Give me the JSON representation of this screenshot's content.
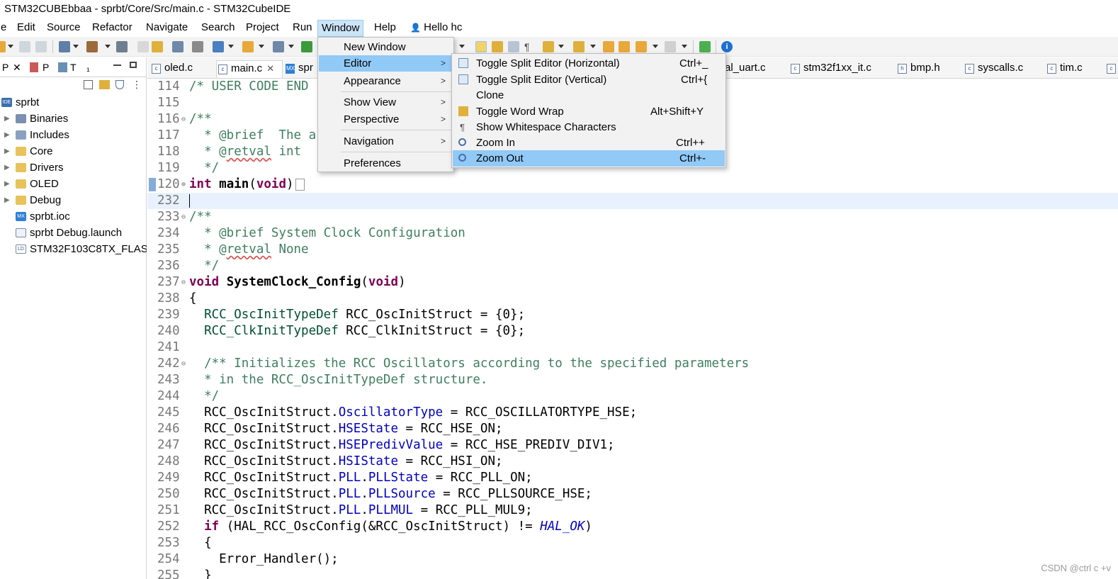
{
  "window": {
    "title": "STM32CUBEbbaa - sprbt/Core/Src/main.c - STM32CubeIDE"
  },
  "menubar": {
    "items": [
      "e",
      "Edit",
      "Source",
      "Refactor",
      "Navigate",
      "Search",
      "Project",
      "Run",
      "Window",
      "Help",
      "Hello hc"
    ],
    "active": "Window"
  },
  "left_panel": {
    "tabs": [
      "P",
      "P",
      "T",
      "₁"
    ],
    "tree": [
      {
        "label": "sprbt",
        "icon": "project-icon"
      },
      {
        "label": "Binaries",
        "icon": "binaries-icon"
      },
      {
        "label": "Includes",
        "icon": "includes-icon"
      },
      {
        "label": "Core",
        "icon": "folder-icon"
      },
      {
        "label": "Drivers",
        "icon": "folder-icon"
      },
      {
        "label": "OLED",
        "icon": "folder-icon"
      },
      {
        "label": "Debug",
        "icon": "folder-icon"
      },
      {
        "label": "sprbt.ioc",
        "icon": "ioc-file-icon"
      },
      {
        "label": "sprbt Debug.launch",
        "icon": "launch-file-icon"
      },
      {
        "label": "STM32F103C8TX_FLAS",
        "icon": "ld-file-icon"
      }
    ]
  },
  "editor_tabs": [
    {
      "label": "oled.c"
    },
    {
      "label": "main.c",
      "active": true
    },
    {
      "label": "spr"
    },
    {
      "label": "al_uart.c"
    },
    {
      "label": "stm32f1xx_it.c"
    },
    {
      "label": "bmp.h"
    },
    {
      "label": "syscalls.c"
    },
    {
      "label": "tim.c"
    }
  ],
  "code_lines": [
    {
      "n": "114",
      "t": "/* USER CODE END"
    },
    {
      "n": "115",
      "t": ""
    },
    {
      "n": "116",
      "t": "/**"
    },
    {
      "n": "117",
      "t": "  * @brief  The a"
    },
    {
      "n": "118",
      "t": "  * @retval int"
    },
    {
      "n": "119",
      "t": "  */"
    },
    {
      "n": "120",
      "t": "int main(void)"
    },
    {
      "n": "232",
      "t": ""
    },
    {
      "n": "233",
      "t": "/**"
    },
    {
      "n": "234",
      "t": "  * @brief System Clock Configuration"
    },
    {
      "n": "235",
      "t": "  * @retval None"
    },
    {
      "n": "236",
      "t": "  */"
    },
    {
      "n": "237",
      "t": "void SystemClock_Config(void)"
    },
    {
      "n": "238",
      "t": "{"
    },
    {
      "n": "239",
      "t": "  RCC_OscInitTypeDef RCC_OscInitStruct = {0};"
    },
    {
      "n": "240",
      "t": "  RCC_ClkInitTypeDef RCC_ClkInitStruct = {0};"
    },
    {
      "n": "241",
      "t": ""
    },
    {
      "n": "242",
      "t": "  /** Initializes the RCC Oscillators according to the specified parameters"
    },
    {
      "n": "243",
      "t": "  * in the RCC_OscInitTypeDef structure."
    },
    {
      "n": "244",
      "t": "  */"
    },
    {
      "n": "245",
      "t": "  RCC_OscInitStruct.OscillatorType = RCC_OSCILLATORTYPE_HSE;"
    },
    {
      "n": "246",
      "t": "  RCC_OscInitStruct.HSEState = RCC_HSE_ON;"
    },
    {
      "n": "247",
      "t": "  RCC_OscInitStruct.HSEPredivValue = RCC_HSE_PREDIV_DIV1;"
    },
    {
      "n": "248",
      "t": "  RCC_OscInitStruct.HSIState = RCC_HSI_ON;"
    },
    {
      "n": "249",
      "t": "  RCC_OscInitStruct.PLL.PLLState = RCC_PLL_ON;"
    },
    {
      "n": "250",
      "t": "  RCC_OscInitStruct.PLL.PLLSource = RCC_PLLSOURCE_HSE;"
    },
    {
      "n": "251",
      "t": "  RCC_OscInitStruct.PLL.PLLMUL = RCC_PLL_MUL9;"
    },
    {
      "n": "252",
      "t": "  if (HAL_RCC_OscConfig(&RCC_OscInitStruct) != HAL_OK)"
    },
    {
      "n": "253",
      "t": "  {"
    },
    {
      "n": "254",
      "t": "    Error_Handler();"
    },
    {
      "n": "255",
      "t": "  }"
    }
  ],
  "window_menu": {
    "items": [
      "New Window",
      "Editor",
      "Appearance",
      "Show View",
      "Perspective",
      "Navigation",
      "Preferences"
    ],
    "selected": "Editor"
  },
  "editor_submenu": {
    "items": [
      {
        "label": "Toggle Split Editor (Horizontal)",
        "shortcut": "Ctrl+_",
        "icon": "split-horizontal-icon"
      },
      {
        "label": "Toggle Split Editor (Vertical)",
        "shortcut": "Ctrl+{",
        "icon": "split-vertical-icon"
      },
      {
        "label": "Clone",
        "shortcut": "",
        "icon": ""
      },
      {
        "label": "Toggle Word Wrap",
        "shortcut": "Alt+Shift+Y",
        "icon": "word-wrap-icon"
      },
      {
        "label": "Show Whitespace Characters",
        "shortcut": "",
        "icon": "pilcrow-icon"
      },
      {
        "label": "Zoom In",
        "shortcut": "Ctrl++",
        "icon": "zoom-in-icon"
      },
      {
        "label": "Zoom Out",
        "shortcut": "Ctrl+-",
        "icon": "zoom-out-icon"
      }
    ],
    "selected": "Zoom Out"
  },
  "watermark": "CSDN @ctrl c +v",
  "colors": {
    "menu_selected": "#91c9f7",
    "keyword": "#7f0055",
    "comment": "#3f7f5f",
    "field": "#0000c0"
  }
}
